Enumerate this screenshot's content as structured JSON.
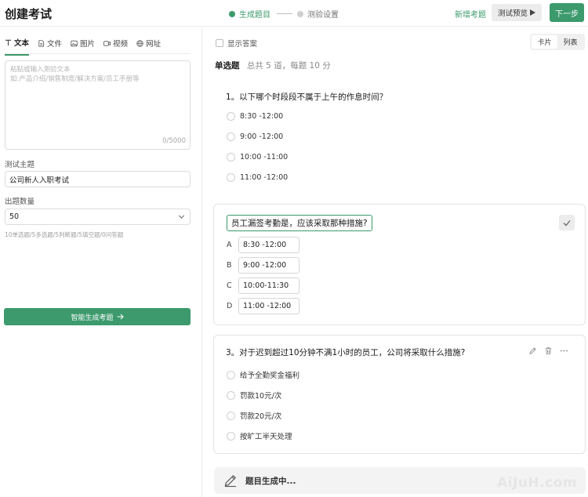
{
  "header": {
    "title": "创建考试",
    "steps": [
      {
        "label": "生成题目",
        "active": true
      },
      {
        "label": "测验设置",
        "active": false
      }
    ],
    "add_question": "新增考题",
    "preview_label": "测试预览",
    "next_label": "下一步",
    "accent": "#3c9a6c"
  },
  "left": {
    "tabs": [
      {
        "label": "文本",
        "icon": "text-icon"
      },
      {
        "label": "文件",
        "icon": "file-icon"
      },
      {
        "label": "图片",
        "icon": "image-icon"
      },
      {
        "label": "视频",
        "icon": "video-icon"
      },
      {
        "label": "网址",
        "icon": "globe-icon"
      }
    ],
    "textarea": {
      "placeholder_line1": "粘贴或输入测验文本",
      "placeholder_line2": "如:产品介绍/销售制度/解决方案/员工手册等",
      "char_count": "0/5000"
    },
    "topic": {
      "label": "测试主题",
      "value": "公司新人入职考试"
    },
    "count": {
      "label": "出题数量",
      "value": "50"
    },
    "distribution": "10单选题/5多选题/5判断题/5填空题/0问答题",
    "generate_label": "智能生成考题"
  },
  "main": {
    "show_answers_label": "显示答案",
    "view_toggle": {
      "card": "卡片",
      "list": "列表"
    },
    "section": {
      "title": "单选题",
      "meta": "总共 5 道，每题 10 分"
    },
    "q1": {
      "title": "1。以下哪个时段段不属于上午的作息时间？",
      "options": [
        "8:30 -12:00",
        "9:00 -12:00",
        "10:00 -11:00",
        "11:00 -12:00"
      ]
    },
    "q2": {
      "title": "员工漏签考勤是，应该采取那种措施?",
      "options": [
        {
          "letter": "A",
          "value": "8:30 -12:00"
        },
        {
          "letter": "B",
          "value": "9:00 -12:00"
        },
        {
          "letter": "C",
          "value": "10:00-11:30"
        },
        {
          "letter": "D",
          "value": "11:00 -12:00"
        }
      ]
    },
    "q3": {
      "title": "3。对于迟到超过10分钟不满1小时的员工，公司将采取什么措施?",
      "options": [
        "给予全勤奖金福利",
        "罚款10元/次",
        "罚款20元/次",
        "按旷工半天处理"
      ]
    },
    "generating_label": "题目生成中..."
  },
  "watermark": "AiJuH.com"
}
